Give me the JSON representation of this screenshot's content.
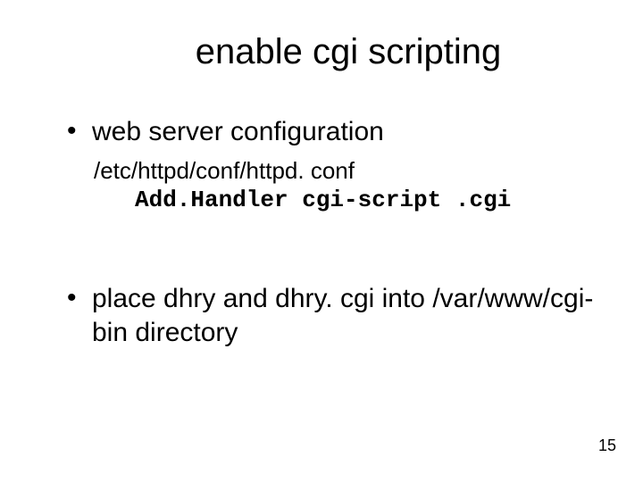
{
  "title": "enable cgi scripting",
  "bullets": {
    "b1": "web server configuration",
    "sub1": "/etc/httpd/conf/httpd. conf",
    "code1": "Add.Handler cgi-script .cgi",
    "b2": "place dhry and dhry. cgi into /var/www/cgi-bin directory"
  },
  "pageNumber": "15"
}
